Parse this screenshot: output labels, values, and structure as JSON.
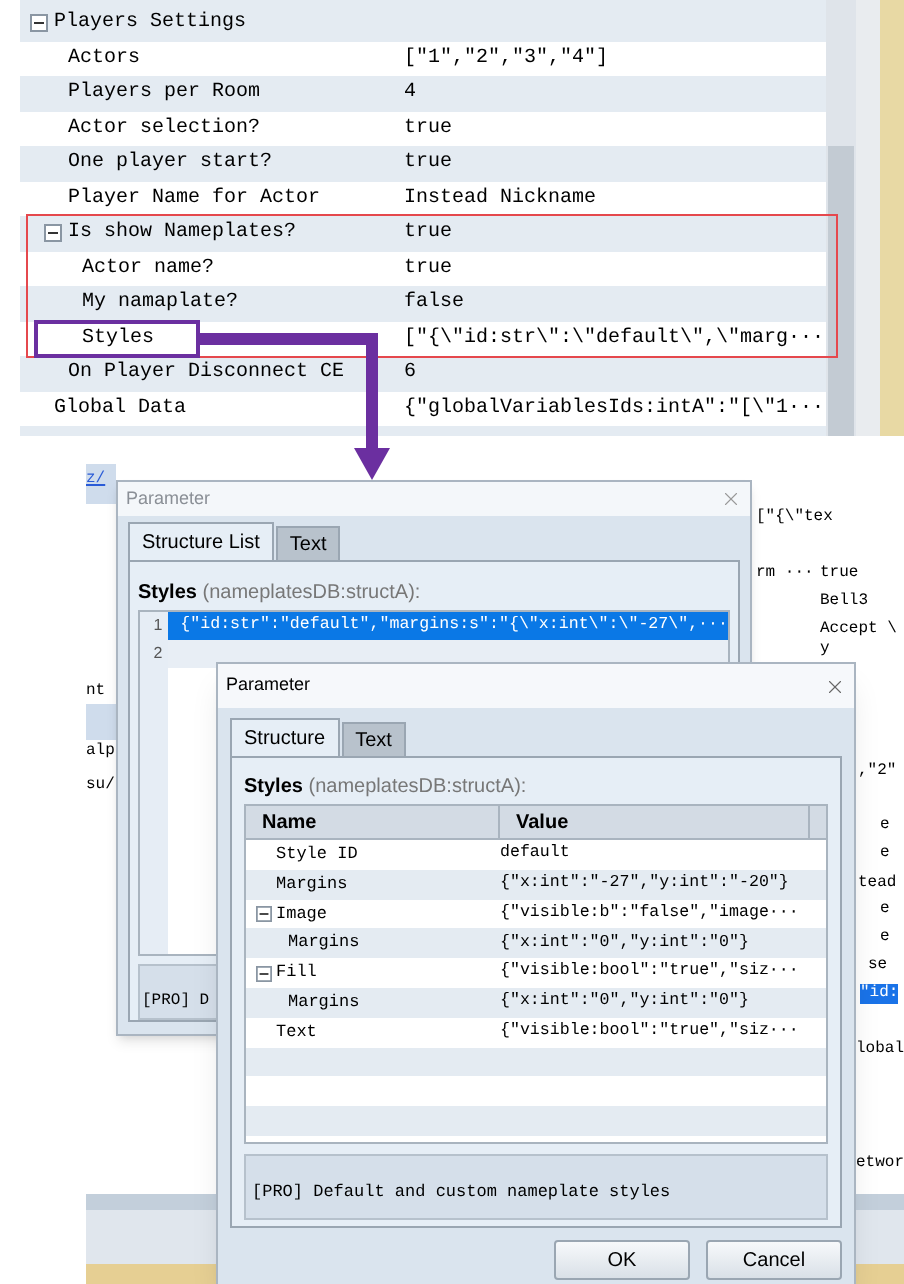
{
  "property_grid": {
    "rows": [
      {
        "name": "Players Settings",
        "expanded": true,
        "children": [
          {
            "name": "Actors",
            "value": "[\"1\",\"2\",\"3\",\"4\"]"
          },
          {
            "name": "Players per Room",
            "value": "4"
          },
          {
            "name": "Actor selection?",
            "value": "true"
          },
          {
            "name": "One player start?",
            "value": "true"
          },
          {
            "name": "Player Name for Actor",
            "value": "Instead Nickname"
          },
          {
            "name": "Is show Nameplates?",
            "value": "true",
            "expanded": true,
            "children": [
              {
                "name": "Actor name?",
                "value": "true"
              },
              {
                "name": "My namaplate?",
                "value": "false"
              },
              {
                "name": "Styles",
                "value": "[\"{\\\"id:str\\\":\\\"default\\\",\\\"marg···"
              }
            ]
          },
          {
            "name": "On Player Disconnect CE",
            "value": "6"
          }
        ]
      },
      {
        "name": "Global Data",
        "value": "{\"globalVariablesIds:intA\":\"[\\\"1···"
      }
    ]
  },
  "background_window": {
    "left_fragments": [
      {
        "text": "z/",
        "kind": "link"
      },
      {
        "text": "nt",
        "kind": "text"
      },
      {
        "text": "alp",
        "kind": "text"
      },
      {
        "text": "su/",
        "kind": "text"
      }
    ],
    "right_fragments": [
      {
        "text": "[\"{\\\"tex",
        "selected": false
      },
      {
        "text": "rm ···",
        "selected": false
      },
      {
        "text": "true",
        "selected": false
      },
      {
        "text": "Bell3",
        "selected": false
      },
      {
        "text": "Accept \\",
        "selected": false
      },
      {
        "text": "y",
        "selected": false
      },
      {
        "text": ",\"2\"",
        "selected": false
      },
      {
        "text": "e",
        "selected": false
      },
      {
        "text": "e",
        "selected": false
      },
      {
        "text": "tead",
        "selected": false
      },
      {
        "text": "e",
        "selected": false
      },
      {
        "text": "e",
        "selected": false
      },
      {
        "text": "se",
        "selected": false
      },
      {
        "text": "\"id:",
        "selected": true
      },
      {
        "text": "lobal",
        "selected": false
      },
      {
        "text": "etwor",
        "selected": false
      }
    ]
  },
  "outer_dialog": {
    "title": "Parameter",
    "tabs": [
      {
        "label": "Structure List",
        "selected": true
      },
      {
        "label": "Text",
        "selected": false
      }
    ],
    "field_label": "Styles",
    "field_type": "(nameplatesDB:structA):",
    "lines": [
      {
        "number": "1",
        "value": "{\"id:str\":\"default\",\"margins:s\":\"{\\\"x:int\\\":\\\"-27\\\",···",
        "selected": true
      },
      {
        "number": "2",
        "selected": false
      }
    ],
    "description": "[PRO] D"
  },
  "inner_dialog": {
    "title": "Parameter",
    "tabs": [
      {
        "label": "Structure",
        "selected": true
      },
      {
        "label": "Text",
        "selected": false
      }
    ],
    "field_label": "Styles",
    "field_type": "(nameplatesDB:structA):",
    "columns": [
      "Name",
      "Value"
    ],
    "rows": [
      {
        "name": "Style ID",
        "value": "default"
      },
      {
        "name": "Margins",
        "value": "{\"x:int\":\"-27\",\"y:int\":\"-20\"}"
      },
      {
        "name": "Image",
        "value": "{\"visible:b\":\"false\",\"image···",
        "expanded": true,
        "children": [
          {
            "name": "Margins",
            "value": "{\"x:int\":\"0\",\"y:int\":\"0\"}"
          }
        ]
      },
      {
        "name": "Fill",
        "value": "{\"visible:bool\":\"true\",\"siz···",
        "expanded": true,
        "children": [
          {
            "name": "Margins",
            "value": "{\"x:int\":\"0\",\"y:int\":\"0\"}"
          }
        ]
      },
      {
        "name": "Text",
        "value": "{\"visible:bool\":\"true\",\"siz···"
      }
    ],
    "description": "[PRO] Default and custom nameplate styles",
    "buttons": [
      "OK",
      "Cancel"
    ]
  }
}
